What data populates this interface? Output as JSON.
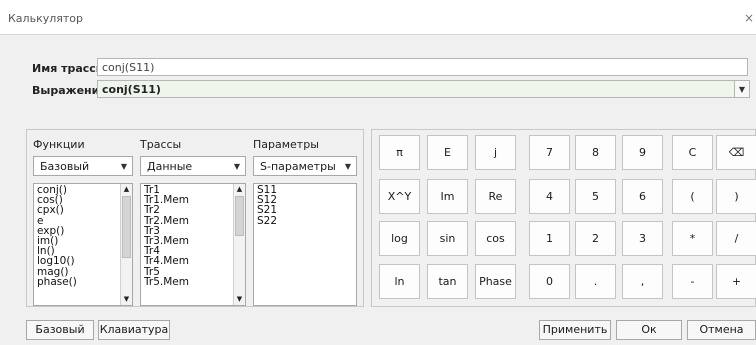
{
  "window": {
    "title": "Калькулятор",
    "close_glyph": "×"
  },
  "form": {
    "trace_name_label": "Имя трассы:",
    "trace_name_value": "conj(S11)",
    "expression_label": "Выражение:",
    "expression_value": "conj(S11)"
  },
  "functions": {
    "header": "Функции",
    "combo_value": "Базовый",
    "items": [
      "conj()",
      "cos()",
      "cpx()",
      "e",
      "exp()",
      "im()",
      "ln()",
      "log10()",
      "mag()",
      "phase()"
    ]
  },
  "traces": {
    "header": "Трассы",
    "combo_value": "Данные",
    "items": [
      "Tr1",
      "Tr1.Mem",
      "Tr2",
      "Tr2.Mem",
      "Tr3",
      "Tr3.Mem",
      "Tr4",
      "Tr4.Mem",
      "Tr5",
      "Tr5.Mem"
    ]
  },
  "params": {
    "header": "Параметры",
    "combo_value": "S-параметры",
    "items": [
      "S11",
      "S12",
      "S21",
      "S22"
    ]
  },
  "keypad": {
    "rows": [
      [
        "π",
        "E",
        "j",
        "7",
        "8",
        "9",
        "C",
        "⌫"
      ],
      [
        "X^Y",
        "Im",
        "Re",
        "4",
        "5",
        "6",
        "(",
        ")"
      ],
      [
        "log",
        "sin",
        "cos",
        "1",
        "2",
        "3",
        "*",
        "/"
      ],
      [
        "ln",
        "tan",
        "Phase",
        "0",
        ".",
        ",",
        "-",
        "+"
      ]
    ]
  },
  "buttons": {
    "basic": "Базовый",
    "keyboard": "Клавиатура",
    "apply": "Применить",
    "ok": "Ок",
    "cancel": "Отмена"
  },
  "icons": {
    "dropdown": "chevron-down-icon",
    "backspace": "backspace-icon",
    "close": "close-icon"
  }
}
